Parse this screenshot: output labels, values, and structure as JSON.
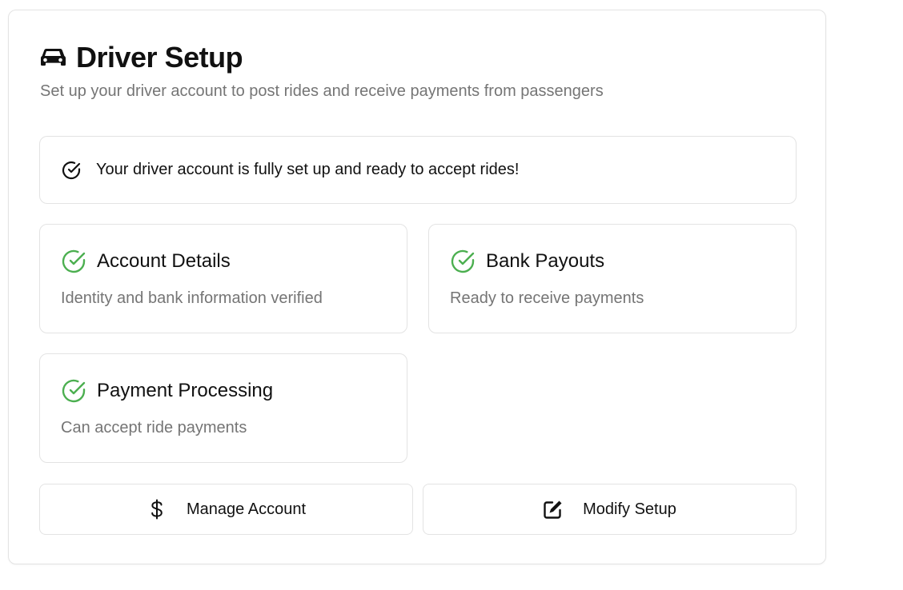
{
  "header": {
    "icon": "car-icon",
    "title": "Driver Setup",
    "subtitle": "Set up your driver account to post rides and receive payments from passengers"
  },
  "alert": {
    "icon": "check-circle-icon",
    "text": "Your driver account is fully set up and ready to accept rides!"
  },
  "status_cards": [
    {
      "icon": "check-circle-icon",
      "label": "Account Details",
      "description": "Identity and bank information verified"
    },
    {
      "icon": "check-circle-icon",
      "label": "Bank Payouts",
      "description": "Ready to receive payments"
    },
    {
      "icon": "check-circle-icon",
      "label": "Payment Processing",
      "description": "Can accept ride payments"
    }
  ],
  "actions": {
    "manage": {
      "icon": "dollar-icon",
      "label": "Manage Account"
    },
    "modify": {
      "icon": "edit-icon",
      "label": "Modify Setup"
    }
  },
  "colors": {
    "success": "#4caf50",
    "text": "#111111",
    "muted": "#757575",
    "border": "#e3e3e3"
  }
}
